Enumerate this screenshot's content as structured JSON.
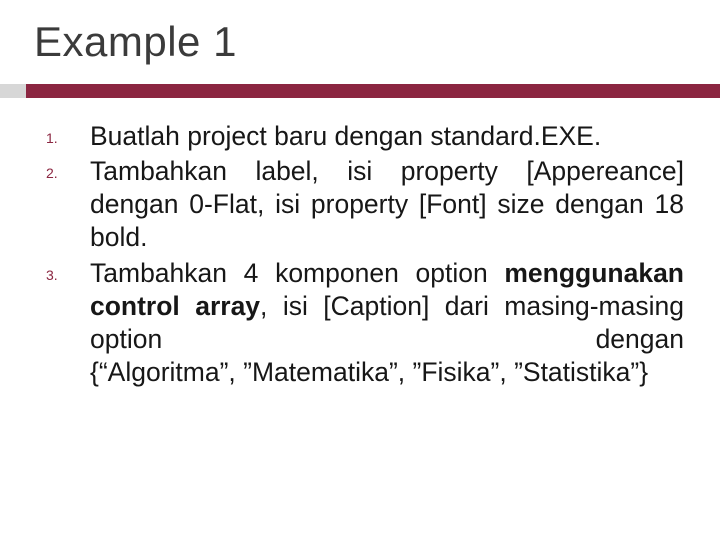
{
  "title": "Example 1",
  "items": [
    {
      "num": "1.",
      "html": "Buatlah project baru dengan standard.EXE."
    },
    {
      "num": "2.",
      "html": "Tambahkan label, isi property [Appereance] dengan 0-Flat, isi property [Font] size dengan 18 bold."
    },
    {
      "num": "3.",
      "html": "Tambahkan 4 komponen option <span class=\"bold\">menggunakan control array</span>, isi [Caption] dari masing-masing option dengan {“Algoritma”, ”Matematika”, ”Fisika”, ”Statistika”}"
    }
  ]
}
